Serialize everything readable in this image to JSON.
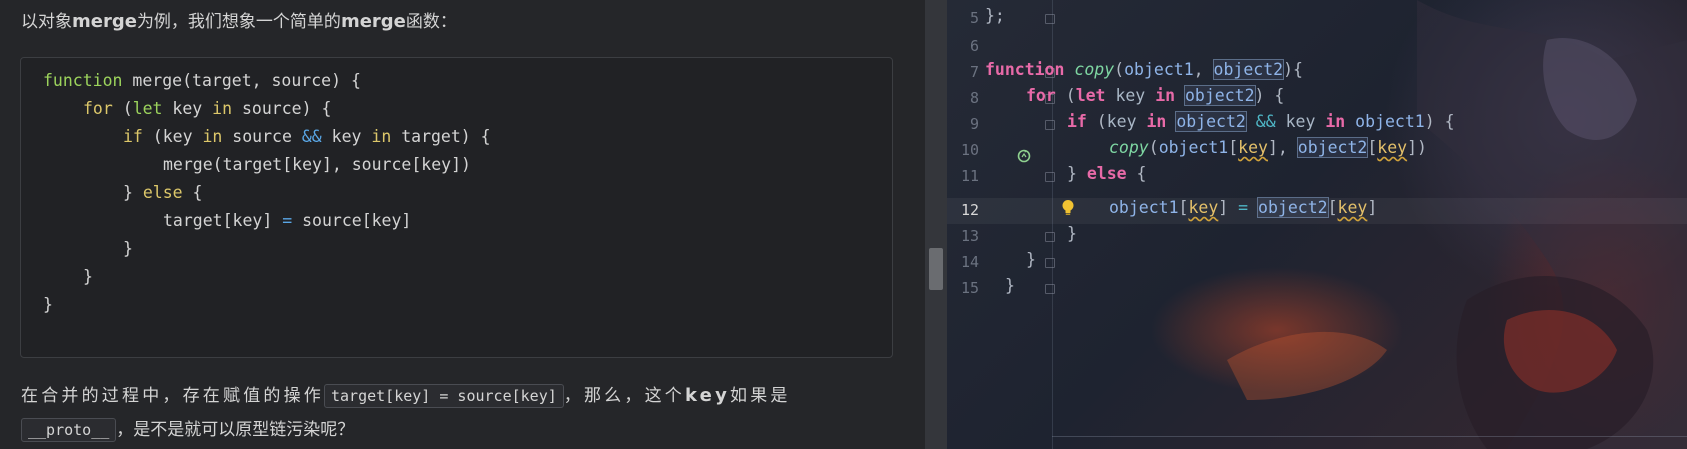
{
  "article": {
    "intro": {
      "prefix": "以对象",
      "kw1": "merge",
      "middle": "为例，我们想象一个简单的",
      "kw2": "merge",
      "suffix": "函数："
    },
    "code_lines": [
      [
        "function",
        " merge(target, source) {"
      ],
      [
        "for",
        " (",
        "let",
        " key ",
        "in",
        " source) {"
      ],
      [
        "if",
        " (key ",
        "in",
        " source ",
        "&&",
        " key ",
        "in",
        " target) {"
      ],
      [
        "merge(target[key], source[key])"
      ],
      [
        "} ",
        "else",
        " {"
      ],
      [
        "target[key] ",
        "=",
        " source[key]"
      ],
      [
        "}"
      ],
      [
        "}"
      ],
      [
        "}"
      ]
    ],
    "para2": {
      "before": "在合并的过程中，存在赋值的操作",
      "code": "target[key] = source[key]",
      "middle": "，那么，这个",
      "key": "key",
      "after": "如果是"
    },
    "para3": {
      "code": "__proto__",
      "after": "，是不是就可以原型链污染呢？"
    }
  },
  "editor": {
    "line_numbers": [
      "5",
      "6",
      "7",
      "8",
      "9",
      "10",
      "11",
      "12",
      "13",
      "14",
      "15"
    ],
    "current_line": "12",
    "lines": {
      "l5": "};",
      "l7_kw": "function",
      "l7_fn": "copy",
      "l7_p1": "object1",
      "l7_p2": "object2",
      "l8_for": "for",
      "l8_let": "let",
      "l8_key": "key",
      "l8_in": "in",
      "l8_obj": "object2",
      "l9_if": "if",
      "l9_key": "key",
      "l9_in": "in",
      "l9_obj2": "object2",
      "l9_and": "&&",
      "l9_key2": "key",
      "l9_in2": "in",
      "l9_obj1": "object1",
      "l10_fn": "copy",
      "l10_obj1": "object1",
      "l10_key1": "key",
      "l10_obj2": "object2",
      "l10_key2": "key",
      "l11_else": "else",
      "l12_obj1": "object1",
      "l12_key1": "key",
      "l12_eq": "=",
      "l12_obj2": "object2",
      "l12_key2": "key"
    },
    "icons": [
      "recursion-gutter-icon",
      "lightbulb-icon"
    ],
    "colors": {
      "keyword": "#e86aa8",
      "function": "#7ed6a2",
      "variable": "#8fb4e8",
      "warning": "#e4c06a"
    }
  }
}
